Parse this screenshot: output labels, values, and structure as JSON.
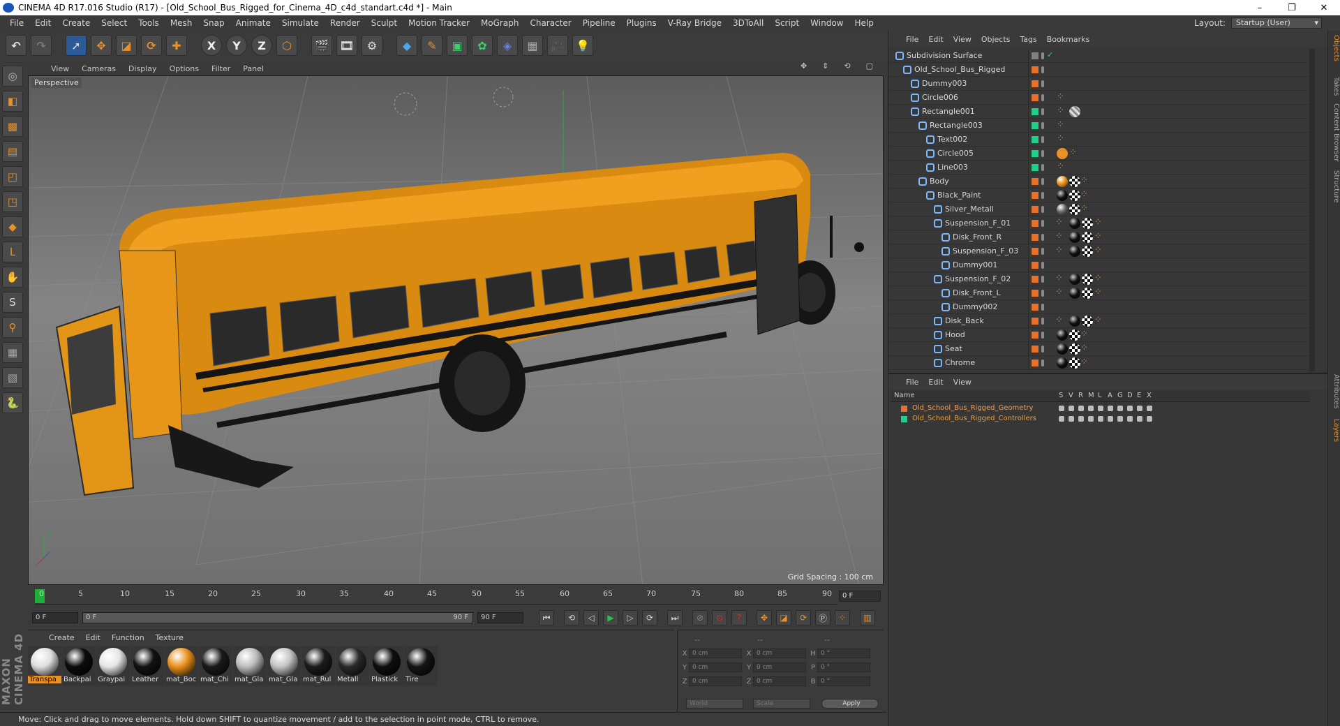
{
  "titlebar": {
    "title": "CINEMA 4D R17.016 Studio (R17) - [Old_School_Bus_Rigged_for_Cinema_4D_c4d_standart.c4d *] - Main",
    "min": "–",
    "max": "❐",
    "close": "✕"
  },
  "menubar": {
    "items": [
      "File",
      "Edit",
      "Create",
      "Select",
      "Tools",
      "Mesh",
      "Snap",
      "Animate",
      "Simulate",
      "Render",
      "Sculpt",
      "Motion Tracker",
      "MoGraph",
      "Character",
      "Pipeline",
      "Plugins",
      "V-Ray Bridge",
      "3DToAll",
      "Script",
      "Window",
      "Help"
    ]
  },
  "layout": {
    "label": "Layout:",
    "value": "Startup (User)"
  },
  "toolbar": {
    "x": "X",
    "y": "Y",
    "z": "Z"
  },
  "viewport": {
    "menu": [
      "View",
      "Cameras",
      "Display",
      "Options",
      "Filter",
      "Panel"
    ],
    "label": "Perspective",
    "grid_spacing": "Grid Spacing : 100 cm",
    "axis_y": "y"
  },
  "timeline": {
    "ticks": [
      "0",
      "5",
      "10",
      "15",
      "20",
      "25",
      "30",
      "35",
      "40",
      "45",
      "50",
      "55",
      "60",
      "65",
      "70",
      "75",
      "80",
      "85",
      "90"
    ],
    "end_field": "0 F",
    "start": "0 F",
    "range_start": "0 F",
    "range_end": "90 F",
    "max": "90 F"
  },
  "materials": {
    "menu": [
      "Create",
      "Edit",
      "Function",
      "Texture"
    ],
    "items": [
      {
        "name": "Transpa",
        "color": "#dedede",
        "selected": true
      },
      {
        "name": "Backpai",
        "color": "#0c0c0c"
      },
      {
        "name": "Graypai",
        "color": "#e6e6e6"
      },
      {
        "name": "Leather",
        "color": "#121212"
      },
      {
        "name": "mat_Boc",
        "color": "#e8901c"
      },
      {
        "name": "mat_Chi",
        "color": "#1a1a1a"
      },
      {
        "name": "mat_Gla",
        "color": "#bdbdbd"
      },
      {
        "name": "mat_Gla",
        "color": "#c4c4c4"
      },
      {
        "name": "mat_Rul",
        "color": "#1c1c1c"
      },
      {
        "name": "Metall",
        "color": "#2a2a2a"
      },
      {
        "name": "Plastick",
        "color": "#0e0e0e"
      },
      {
        "name": "Tire",
        "color": "#141414"
      }
    ]
  },
  "coords": {
    "head": [
      "--",
      "--",
      "--"
    ],
    "rows": [
      {
        "a": "X",
        "av": "0 cm",
        "b": "X",
        "bv": "0 cm",
        "c": "H",
        "cv": "0 °"
      },
      {
        "a": "Y",
        "av": "0 cm",
        "b": "Y",
        "bv": "0 cm",
        "c": "P",
        "cv": "0 °"
      },
      {
        "a": "Z",
        "av": "0 cm",
        "b": "Z",
        "bv": "0 cm",
        "c": "B",
        "cv": "0 °"
      }
    ],
    "world": "World",
    "scale": "Scale",
    "apply": "Apply"
  },
  "status": "Move: Click and drag to move elements. Hold down SHIFT to quantize movement / add to the selection in point mode, CTRL to remove.",
  "objects": {
    "menu": [
      "File",
      "Edit",
      "View",
      "Objects",
      "Tags",
      "Bookmarks"
    ],
    "rows": [
      {
        "name": "Subdivision Surface",
        "indent": 0,
        "color": "#7f7f7f",
        "tag": "",
        "check": true
      },
      {
        "name": "Old_School_Bus_Rigged",
        "indent": 1,
        "color": "#e8712a",
        "tag": ""
      },
      {
        "name": "Dummy003",
        "indent": 2,
        "color": "#e8712a",
        "tag": ""
      },
      {
        "name": "Circle006",
        "indent": 2,
        "color": "#e8712a",
        "tag": "dots"
      },
      {
        "name": "Rectangle001",
        "indent": 2,
        "color": "#1fcf8a",
        "tag": "dots-check"
      },
      {
        "name": "Rectangle003",
        "indent": 3,
        "color": "#1fcf8a",
        "tag": "dots"
      },
      {
        "name": "Text002",
        "indent": 4,
        "color": "#1fcf8a",
        "tag": "dots"
      },
      {
        "name": "Circle005",
        "indent": 4,
        "color": "#1fcf8a",
        "tag": "forbid"
      },
      {
        "name": "Line003",
        "indent": 4,
        "color": "#1fcf8a",
        "tag": "dots"
      },
      {
        "name": "Body",
        "indent": 3,
        "color": "#e8712a",
        "tag": "orange"
      },
      {
        "name": "Black_Paint",
        "indent": 4,
        "color": "#e8712a",
        "tag": "black"
      },
      {
        "name": "Silver_Metall",
        "indent": 5,
        "color": "#e8712a",
        "tag": "grey"
      },
      {
        "name": "Suspension_F_01",
        "indent": 5,
        "color": "#e8712a",
        "tag": "rig"
      },
      {
        "name": "Disk_Front_R",
        "indent": 6,
        "color": "#e8712a",
        "tag": "rig"
      },
      {
        "name": "Suspension_F_03",
        "indent": 6,
        "color": "#e8712a",
        "tag": "rig"
      },
      {
        "name": "Dummy001",
        "indent": 6,
        "color": "#e8712a",
        "tag": ""
      },
      {
        "name": "Suspension_F_02",
        "indent": 5,
        "color": "#e8712a",
        "tag": "rig"
      },
      {
        "name": "Disk_Front_L",
        "indent": 6,
        "color": "#e8712a",
        "tag": "rig"
      },
      {
        "name": "Dummy002",
        "indent": 6,
        "color": "#e8712a",
        "tag": ""
      },
      {
        "name": "Disk_Back",
        "indent": 5,
        "color": "#e8712a",
        "tag": "rig"
      },
      {
        "name": "Hood",
        "indent": 5,
        "color": "#e8712a",
        "tag": "black"
      },
      {
        "name": "Seat",
        "indent": 5,
        "color": "#e8712a",
        "tag": "black"
      },
      {
        "name": "Chrome",
        "indent": 5,
        "color": "#e8712a",
        "tag": "black"
      }
    ]
  },
  "layers": {
    "menu": [
      "File",
      "Edit",
      "View"
    ],
    "header": {
      "name": "Name",
      "flags": [
        "S",
        "V",
        "R",
        "M",
        "L",
        "A",
        "G",
        "D",
        "E",
        "X"
      ]
    },
    "rows": [
      {
        "name": "Old_School_Bus_Rigged_Geometry",
        "color": "#e8712a",
        "text": "#e8a060"
      },
      {
        "name": "Old_School_Bus_Rigged_Controllers",
        "color": "#1fcf8a",
        "text": "#f0a030"
      }
    ]
  },
  "sidetabs": [
    "Objects",
    "Takes",
    "Content Browser",
    "Structure",
    "Attributes",
    "Layers"
  ]
}
